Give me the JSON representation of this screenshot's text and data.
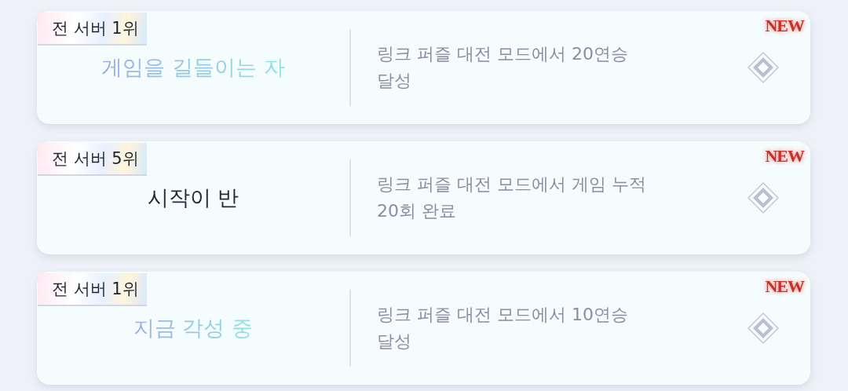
{
  "achievements": [
    {
      "rank": "전 서버 1위",
      "title": "게임을 길들이는 자",
      "kind": "gradient",
      "description": "링크 퍼즐 대전 모드에서 20연승 달성",
      "badge": "NEW"
    },
    {
      "rank": "전 서버 5위",
      "title": "시작이 반",
      "kind": "plain",
      "description": "링크 퍼즐 대전 모드에서 게임 누적 20회 완료",
      "badge": "NEW"
    },
    {
      "rank": "전 서버 1위",
      "title": "지금 각성 중",
      "kind": "gradient",
      "description": "링크 퍼즐 대전 모드에서 10연승 달성",
      "badge": "NEW"
    }
  ]
}
